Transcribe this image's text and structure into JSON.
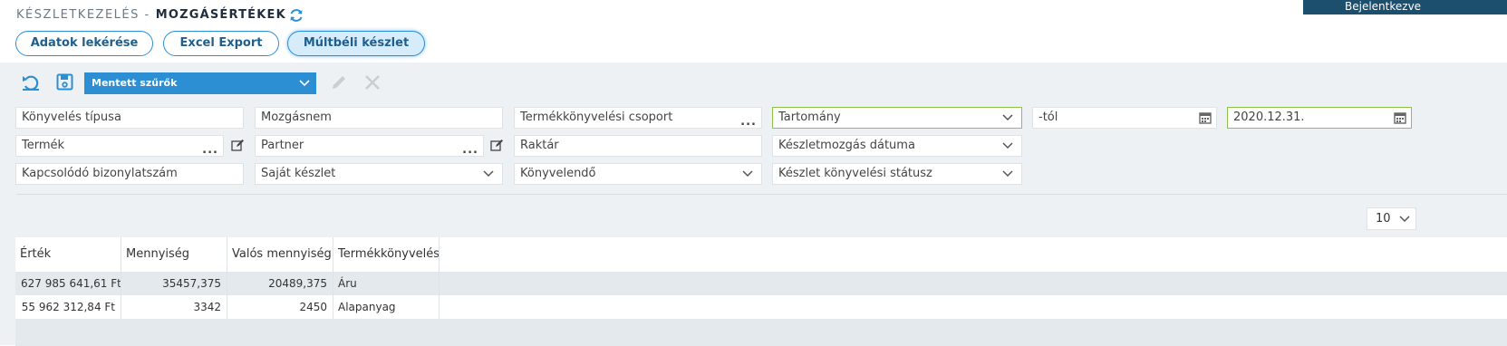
{
  "header": {
    "section": "KÉSZLETKEZELÉS -",
    "page": "MOZGÁSÉRTÉKEK",
    "login_status": "Bejelentkezve"
  },
  "actions": {
    "fetch": "Adatok lekérése",
    "excel": "Excel Export",
    "history": "Múltbéli készlet"
  },
  "toolbar": {
    "saved_filters": "Mentett szűrők"
  },
  "filters": {
    "booking_type": "Könyvelés típusa",
    "movement_name": "Mozgásnem",
    "product_group": "Termékkönyvelési csoport",
    "range": "Tartomány",
    "from": "-tól",
    "to_date": "2020.12.31.",
    "product": "Termék",
    "partner": "Partner",
    "warehouse": "Raktár",
    "movement_date": "Készletmozgás dátuma",
    "related_doc": "Kapcsolódó bizonylatszám",
    "own_stock": "Saját készlet",
    "to_be_booked": "Könyvelendő",
    "booking_status": "Készlet könyvelési státusz",
    "dots": "..."
  },
  "pager": {
    "page_size": "10"
  },
  "table": {
    "columns": [
      "Érték",
      "Mennyiség",
      "Valós mennyiség",
      "Termékkönyvelési csoport"
    ],
    "rows": [
      [
        "627 985 641,61 Ft",
        "35457,375",
        "20489,375",
        "Áru"
      ],
      [
        "55 962 312,84 Ft",
        "3342",
        "2450",
        "Alapanyag"
      ]
    ]
  },
  "colors": {
    "accent": "#2d8fd3",
    "panel": "#edf1f4",
    "valid": "#8bc34a",
    "row_alt": "#e4e9ee"
  }
}
